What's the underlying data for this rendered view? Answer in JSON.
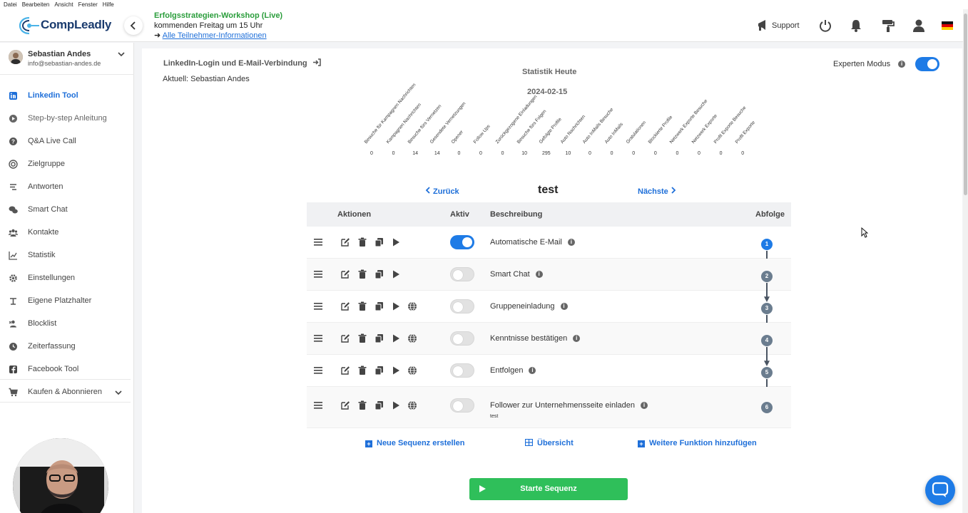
{
  "menubar": [
    "Datei",
    "Bearbeiten",
    "Ansicht",
    "Fenster",
    "Hilfe"
  ],
  "header": {
    "logo_text": "CompLeadly",
    "workshop_title": "Erfolgsstrategien-Workshop (Live)",
    "workshop_when": "kommenden Freitag um 15 Uhr",
    "workshop_arrow": "➜",
    "workshop_link": "Alle Teilnehmer-Informationen",
    "support_label": "Support",
    "icons": [
      "megaphone-icon",
      "power-icon",
      "bell-icon",
      "paint-roller-icon",
      "user-icon",
      "german-flag-icon"
    ]
  },
  "user": {
    "name": "Sebastian Andes",
    "email": "info@sebastian-andes.de"
  },
  "sidebar": {
    "items": [
      {
        "label": "Linkedin Tool",
        "icon": "linkedin-icon",
        "active": true
      },
      {
        "label": "Step-by-step Anleitung",
        "icon": "play-circle-icon"
      },
      {
        "label": "Q&A Live Call",
        "icon": "question-icon"
      },
      {
        "label": "Zielgruppe",
        "icon": "target-icon"
      },
      {
        "label": "Antworten",
        "icon": "reply-icon"
      },
      {
        "label": "Smart Chat",
        "icon": "chat-icon"
      },
      {
        "label": "Kontakte",
        "icon": "contacts-icon"
      },
      {
        "label": "Statistik",
        "icon": "chart-icon"
      },
      {
        "label": "Einstellungen",
        "icon": "gear-icon"
      },
      {
        "label": "Eigene Platzhalter",
        "icon": "placeholder-icon"
      },
      {
        "label": "Blocklist",
        "icon": "block-icon"
      },
      {
        "label": "Zeiterfassung",
        "icon": "clock-icon"
      },
      {
        "label": "Facebook Tool",
        "icon": "facebook-icon"
      },
      {
        "label": "Kaufen & Abonnieren",
        "icon": "cart-icon"
      }
    ]
  },
  "main": {
    "login_label": "LinkedIn-Login und E-Mail-Verbindung",
    "current_user": "Aktuell: Sebastian Andes",
    "stat_title": "Statistik Heute",
    "stat_date": "2024-02-15",
    "expert_label": "Experten Modus",
    "expert_on": true,
    "stats": [
      {
        "label": "Besuche für Kampagnen Nachrichten",
        "value": "0"
      },
      {
        "label": "Kampagnen Nachrichten",
        "value": "0"
      },
      {
        "label": "Besuche fürs Vernetzen",
        "value": "14"
      },
      {
        "label": "Gesendete Vernetzungen",
        "value": "14"
      },
      {
        "label": "Opener",
        "value": "0"
      },
      {
        "label": "Follow Ups",
        "value": "0"
      },
      {
        "label": "Zurückgezogene Einladungen",
        "value": "0"
      },
      {
        "label": "Besuche fürs Folgen",
        "value": "10"
      },
      {
        "label": "Gefolgte Profile",
        "value": "295"
      },
      {
        "label": "Auto Nachrichten",
        "value": "10"
      },
      {
        "label": "Auto InMails Besuche",
        "value": "0"
      },
      {
        "label": "Auto InMails",
        "value": "0"
      },
      {
        "label": "Gratulationen",
        "value": "0"
      },
      {
        "label": "Blockierte Profile",
        "value": "0"
      },
      {
        "label": "Netzwerk Exporte Besuche",
        "value": "0"
      },
      {
        "label": "Netzwerk Exporte",
        "value": "0"
      },
      {
        "label": "Profil Exporte Besuche",
        "value": "0"
      },
      {
        "label": "Profil Exporte",
        "value": "0"
      }
    ],
    "nav_back": "Zurück",
    "sequence_name": "test",
    "nav_next": "Nächste",
    "table": {
      "headers": {
        "actions": "Aktionen",
        "active": "Aktiv",
        "description": "Beschreibung",
        "order": "Abfolge"
      },
      "rows": [
        {
          "description": "Automatische E-Mail",
          "active": true,
          "globe": false,
          "step": "1",
          "sub": ""
        },
        {
          "description": "Smart Chat",
          "active": false,
          "globe": false,
          "step": "2",
          "sub": ""
        },
        {
          "description": "Gruppeneinladung",
          "active": false,
          "globe": true,
          "step": "3",
          "sub": ""
        },
        {
          "description": "Kenntnisse bestätigen",
          "active": false,
          "globe": true,
          "step": "4",
          "sub": ""
        },
        {
          "description": "Entfolgen",
          "active": false,
          "globe": true,
          "step": "5",
          "sub": ""
        },
        {
          "description": "Follower zur Unternehmensseite einladen",
          "active": false,
          "globe": true,
          "step": "6",
          "sub": "test"
        }
      ]
    },
    "footer_links": {
      "new_sequence": "Neue Sequenz erstellen",
      "overview": "Übersicht",
      "add_function": "Weitere Funktion hinzufügen"
    },
    "start_button": "Starte Sequenz"
  },
  "colors": {
    "accent": "#1e7be6",
    "link": "#1e6fd9",
    "success": "#2fbf5a",
    "workshop_green": "#2a9d3b",
    "logo_navy": "#1a3b6e"
  }
}
